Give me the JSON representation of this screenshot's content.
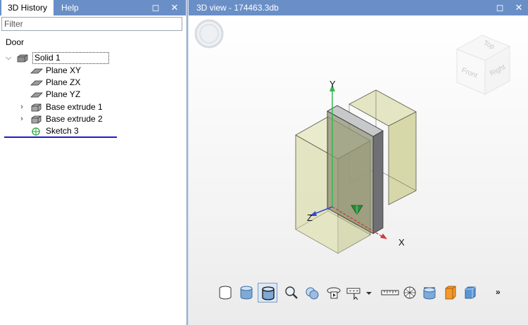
{
  "left_panel": {
    "tabs": [
      {
        "label": "3D History",
        "active": true
      },
      {
        "label": "Help",
        "active": false
      }
    ],
    "filter_placeholder": "Filter",
    "root_label": "Door",
    "tree": [
      {
        "label": "Solid 1",
        "expanded": true,
        "icon": "solid-icon"
      },
      {
        "label": "Plane XY",
        "icon": "plane-icon"
      },
      {
        "label": "Plane ZX",
        "icon": "plane-icon"
      },
      {
        "label": "Plane YZ",
        "icon": "plane-icon"
      },
      {
        "label": "Base extrude 1",
        "expanded": false,
        "icon": "extrude-icon"
      },
      {
        "label": "Base extrude 2",
        "expanded": false,
        "icon": "extrude-icon"
      },
      {
        "label": "Sketch 3",
        "icon": "sketch-icon"
      }
    ]
  },
  "right_panel": {
    "title": "3D view - 174463.3db",
    "viewcube": {
      "top": "Top",
      "front": "Front",
      "right": "Right"
    },
    "axes": {
      "x": "X",
      "y": "Y",
      "z": "Z"
    },
    "toolbar_more": "»"
  },
  "window_buttons": {
    "maximize": "◻",
    "close": "✕"
  },
  "colors": {
    "tab_bar": "#6a8fc7",
    "solid_face": "#d5d7a8",
    "panel_face": "#9c9ea1",
    "selection_underline": "#1c1ccf",
    "axis_x": "#d13a3a",
    "axis_y": "#35b84c",
    "axis_z": "#3549d1"
  }
}
